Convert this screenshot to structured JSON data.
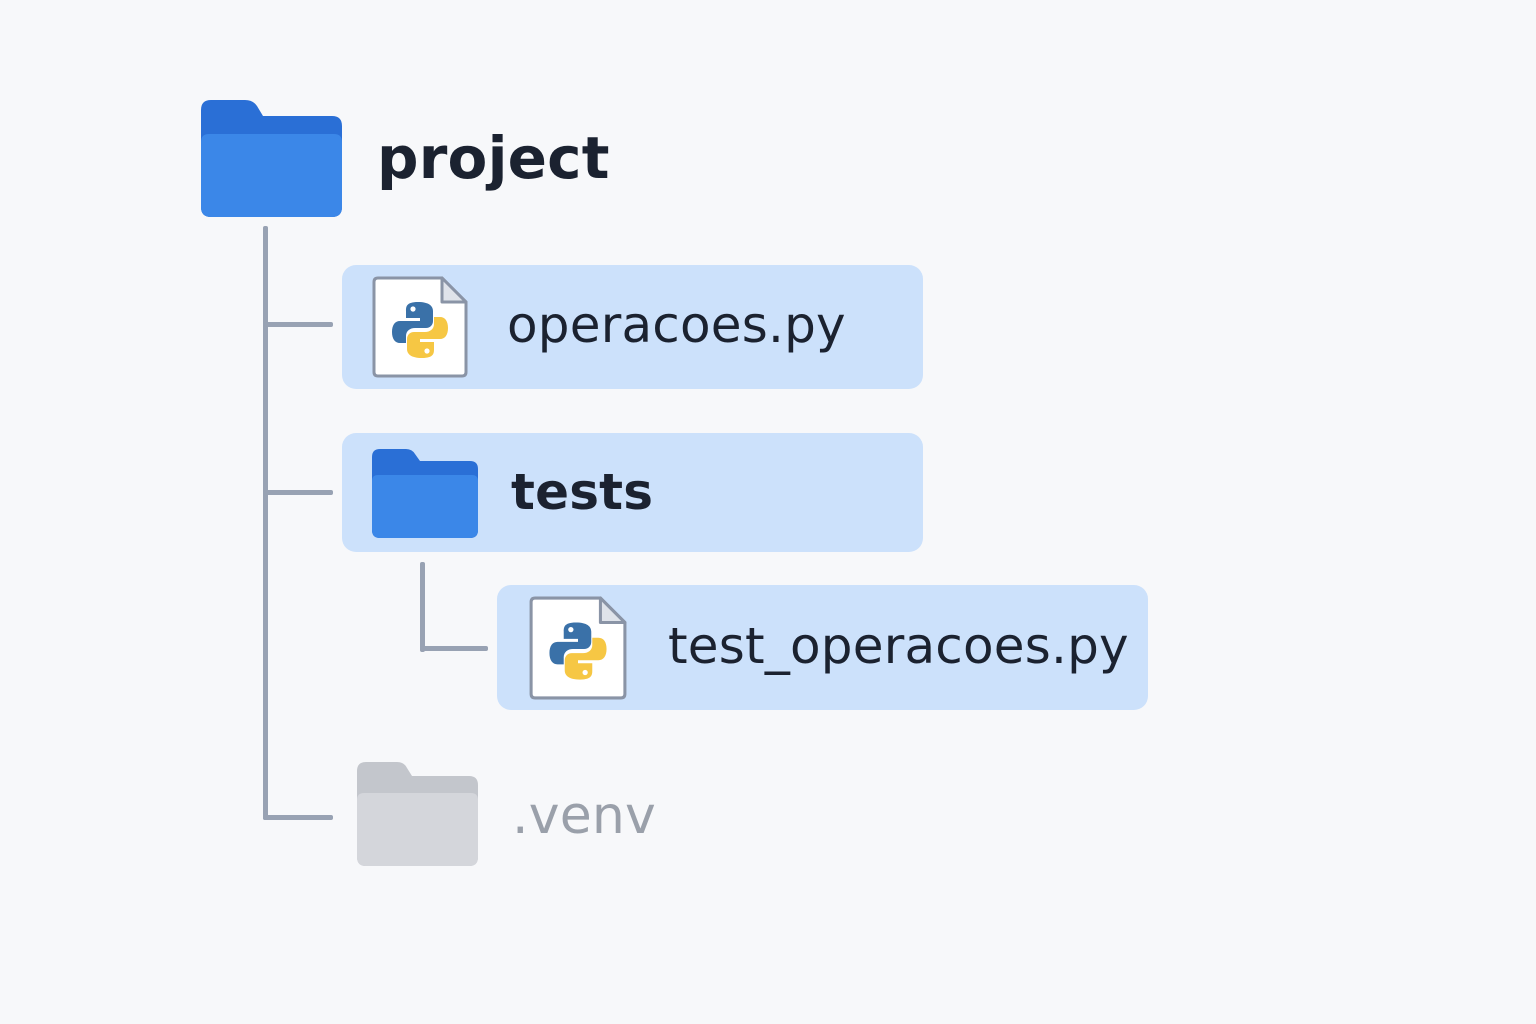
{
  "tree": {
    "root": {
      "label": "project",
      "icon": "folder-icon",
      "color": "#2f7de1"
    },
    "items": [
      {
        "label": "operacoes.py",
        "icon": "python-file-icon",
        "highlighted": true
      },
      {
        "label": "tests",
        "icon": "folder-icon",
        "highlighted": true
      },
      {
        "label": "test_operacoes.py",
        "icon": "python-file-icon",
        "highlighted": true
      },
      {
        "label": ".venv",
        "icon": "folder-icon",
        "muted": true
      }
    ]
  },
  "colors": {
    "highlight": "#cce1fb",
    "folder_blue": "#3b87e8",
    "folder_gray": "#d4d6db",
    "connector": "#98a2b3",
    "python_blue": "#3a71a8",
    "python_yellow": "#f6c744",
    "muted_text": "#9aa0aa"
  }
}
